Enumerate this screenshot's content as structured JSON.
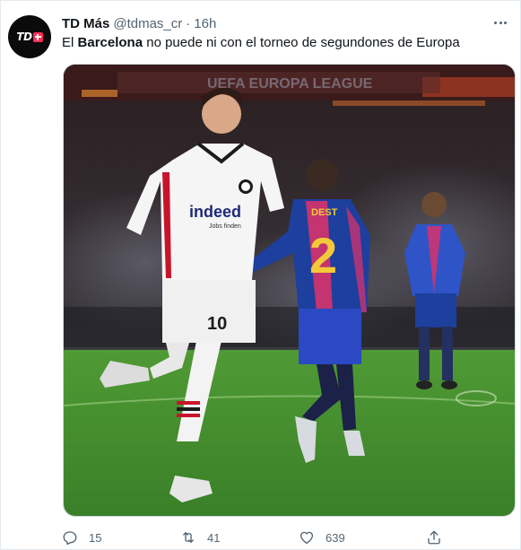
{
  "author": {
    "avatar_text": "TD",
    "display_name": "TD Más",
    "handle": "@tdmas_cr",
    "separator": "·",
    "time": "16h"
  },
  "tweet": {
    "text_before": "El ",
    "text_bold": "Barcelona",
    "text_after": " no puede ni con el torneo de segundones de Europa"
  },
  "media": {
    "banner_text": "UEFA EUROPA LEAGUE",
    "sponsor_text": "indeed",
    "sponsor_subtext": "Jobs finden",
    "player1_number": "10",
    "player2_name": "DEST",
    "player2_number": "2"
  },
  "actions": {
    "reply_count": "15",
    "retweet_count": "41",
    "like_count": "639"
  },
  "colors": {
    "text_primary": "#0f1419",
    "text_secondary": "#536471",
    "barca_blue": "#1d3f9e",
    "barca_pink": "#d6336c",
    "pitch_green": "#3f8a2c"
  }
}
